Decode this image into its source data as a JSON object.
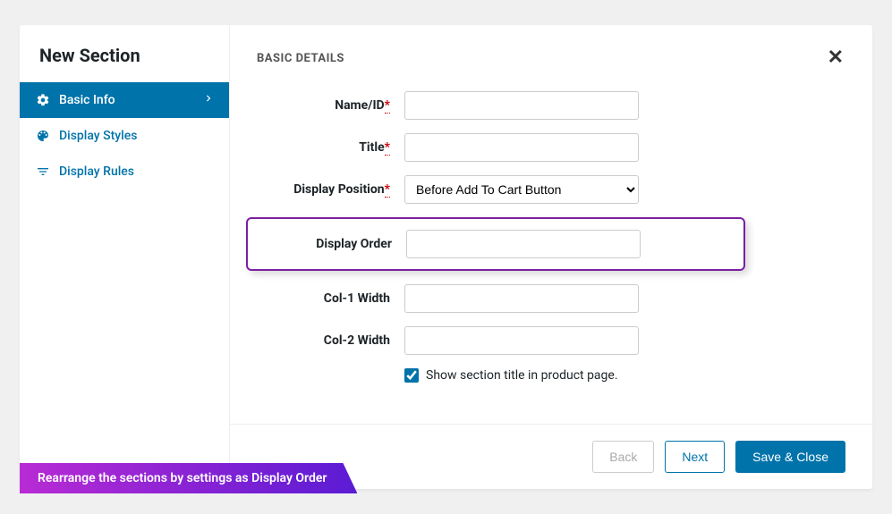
{
  "sidebar": {
    "title": "New Section",
    "items": [
      {
        "label": "Basic Info"
      },
      {
        "label": "Display Styles"
      },
      {
        "label": "Display Rules"
      }
    ]
  },
  "panel": {
    "title": "BASIC DETAILS"
  },
  "form": {
    "name_label": "Name/ID",
    "name_value": "",
    "title_label": "Title",
    "title_value": "",
    "position_label": "Display Position",
    "position_value": "Before Add To Cart Button",
    "order_label": "Display Order",
    "order_value": "",
    "col1_label": "Col-1 Width",
    "col1_value": "",
    "col2_label": "Col-2 Width",
    "col2_value": "",
    "show_title_label": "Show section title in product page.",
    "show_title_checked": true
  },
  "footer": {
    "back": "Back",
    "next": "Next",
    "save": "Save & Close"
  },
  "annotation": "Rearrange the sections by settings as Display Order"
}
